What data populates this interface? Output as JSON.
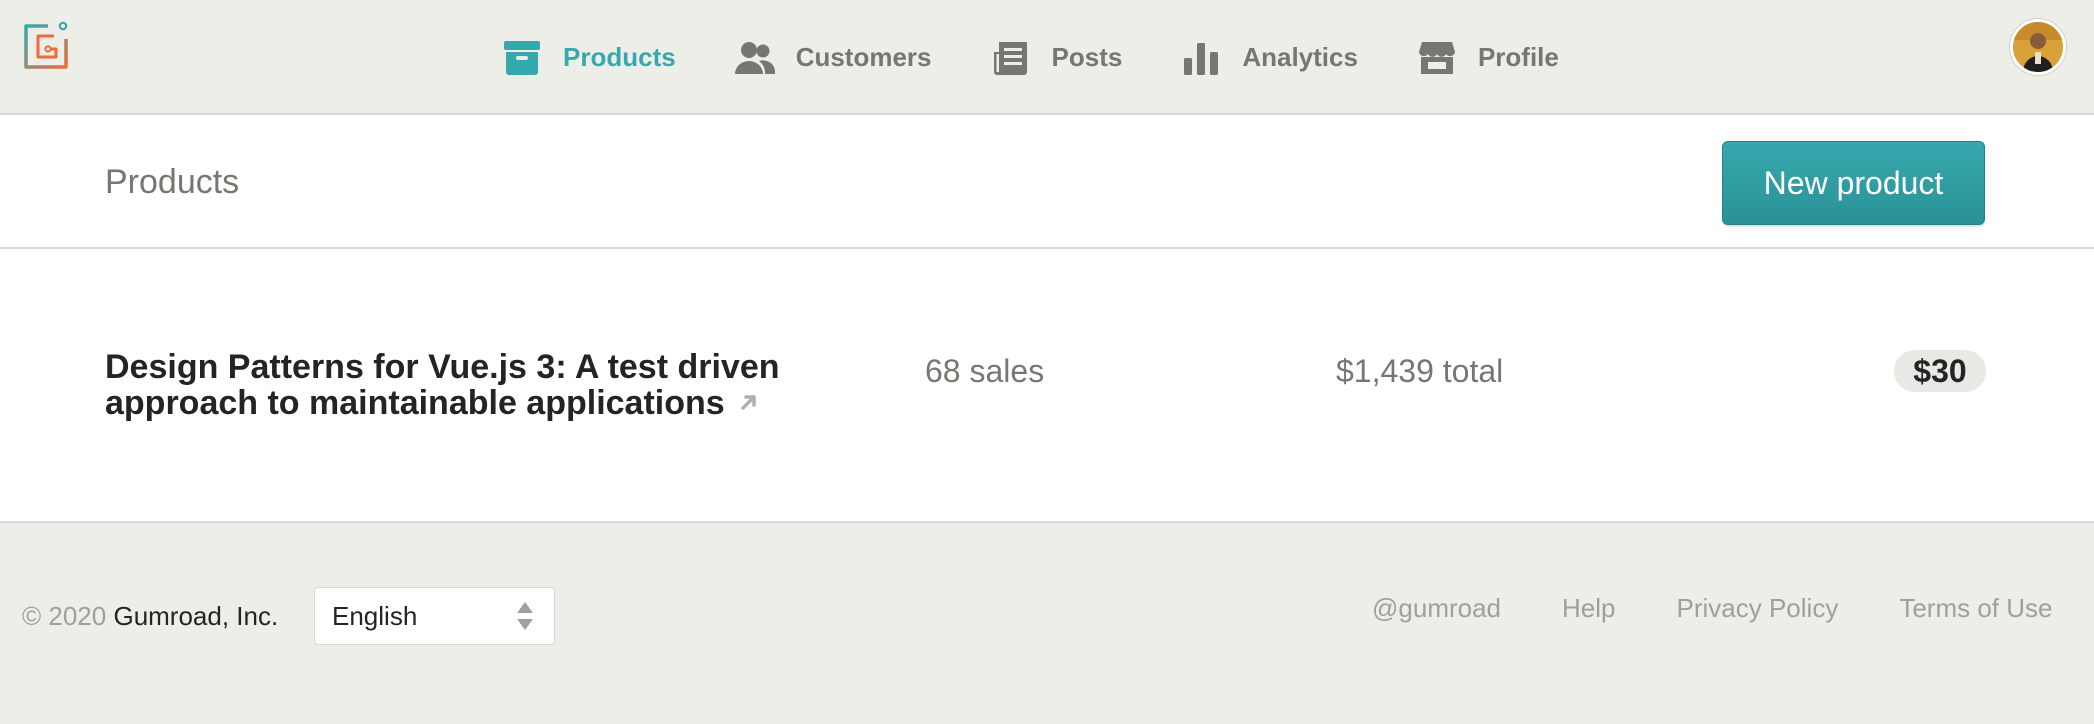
{
  "nav": {
    "items": [
      {
        "label": "Products",
        "icon": "archive-box-icon"
      },
      {
        "label": "Customers",
        "icon": "users-icon"
      },
      {
        "label": "Posts",
        "icon": "newspaper-icon"
      },
      {
        "label": "Analytics",
        "icon": "bar-chart-icon"
      },
      {
        "label": "Profile",
        "icon": "storefront-icon"
      }
    ],
    "active": "Products"
  },
  "header": {
    "title": "Products",
    "new_button": "New product"
  },
  "products": [
    {
      "name": "Design Patterns for Vue.js 3: A test driven approach to maintainable applications",
      "sales": "68 sales",
      "total": "$1,439 total",
      "price": "$30"
    }
  ],
  "footer": {
    "copyright": "© 2020",
    "company": "Gumroad, Inc.",
    "language": "English",
    "links": [
      "@gumroad",
      "Help",
      "Privacy Policy",
      "Terms of Use"
    ]
  },
  "colors": {
    "accent": "#36a9ae",
    "background": "#eeeee9",
    "muted_text": "#777772"
  }
}
